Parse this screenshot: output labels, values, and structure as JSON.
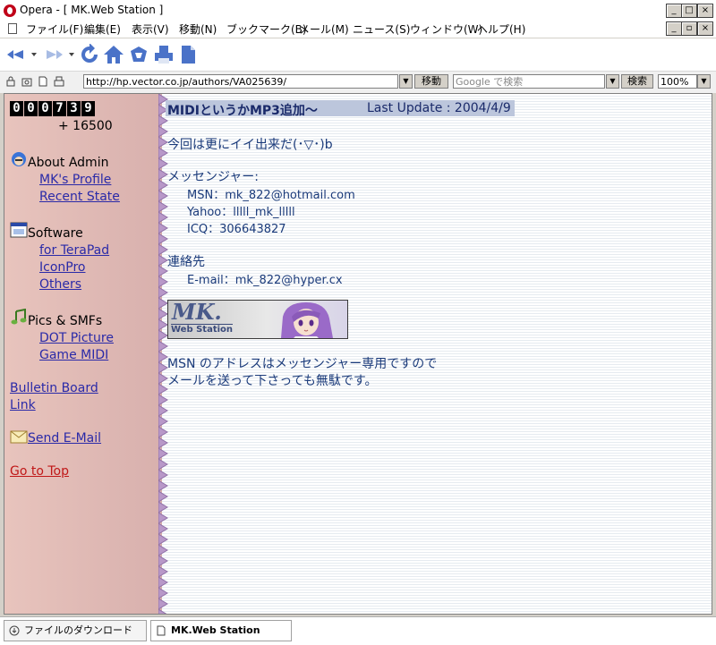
{
  "window": {
    "title": "Opera - [ MK.Web Station ]",
    "minimize_glyph": "_",
    "maximize_glyph": "□",
    "close_glyph": "×",
    "restore_glyph": "▫"
  },
  "menu": {
    "items": [
      "ファイル(F)",
      "編集(E)",
      "表示(V)",
      "移動(N)",
      "ブックマーク(B)",
      "メール(M)",
      "ニュース(S)",
      "ウィンドウ(W)",
      "ヘルプ(H)"
    ]
  },
  "address_bar": {
    "url": "http://hp.vector.co.jp/authors/VA025639/",
    "go_label": "移動",
    "search_placeholder": "Google で検索",
    "search_label": "検索",
    "zoom": "100%"
  },
  "sidebar": {
    "counter_digits": [
      "0",
      "0",
      "0",
      "7",
      "3",
      "9"
    ],
    "counter_offset": "+ 16500",
    "about_heading": "About Admin",
    "about_links": [
      "MK's Profile",
      "Recent State"
    ],
    "software_heading": "Software",
    "software_links": [
      "for TeraPad",
      "IconPro",
      "Others"
    ],
    "pics_heading": "Pics & SMFs",
    "pics_links": [
      "DOT Picture",
      "Game MIDI"
    ],
    "bulletin_link": "Bulletin Board",
    "link_link": "Link",
    "send_email": "Send E-Mail",
    "go_to_top": "Go to Top"
  },
  "main": {
    "headline": "MIDIというかMP3追加〜",
    "last_update": "Last Update : 2004/4/9",
    "greeting": "今回は更にイイ出来だ(･▽･)b",
    "messenger_heading": "メッセンジャー:",
    "msn": "MSN：mk_822@hotmail.com",
    "yahoo": "Yahoo：lllll_mk_lllll",
    "icq": "ICQ：306643827",
    "contact_heading": "連絡先",
    "email": "E-mail：mk_822@hyper.cx",
    "banner_title": "MK.",
    "banner_subtitle": "Web Station",
    "note_line1": "MSN のアドレスはメッセンジャー専用ですので",
    "note_line2": "メールを送って下さっても無駄です。"
  },
  "tabs": [
    {
      "label": "ファイルのダウンロード"
    },
    {
      "label": "MK.Web Station"
    }
  ]
}
